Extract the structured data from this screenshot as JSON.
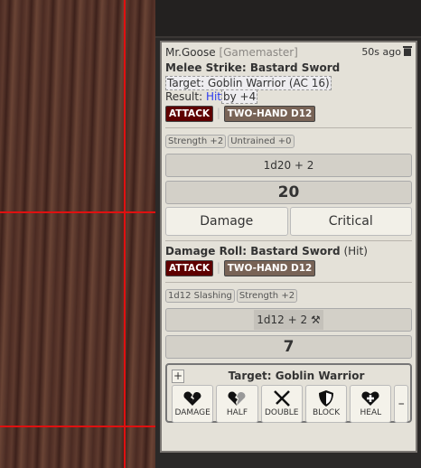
{
  "message": {
    "speaker": "Mr.Goose",
    "role": "[Gamemaster]",
    "time": "50s ago",
    "attack": {
      "title": "Melee Strike: Bastard Sword",
      "target": "Target: Goblin Warrior (AC 16)",
      "result_label": "Result:",
      "result": "Hit",
      "by": "by +4",
      "tags": [
        "ATTACK",
        "TWO-HAND D12"
      ],
      "modifiers": [
        "Strength +2",
        "Untrained +0"
      ],
      "formula": "1d20 + 2",
      "total": "20",
      "damage_btn": "Damage",
      "critical_btn": "Critical"
    },
    "damage": {
      "title": "Damage Roll: Bastard Sword",
      "outcome": "(Hit)",
      "tags": [
        "ATTACK",
        "TWO-HAND D12"
      ],
      "modifiers": [
        "1d12 Slashing",
        "Strength +2"
      ],
      "formula": "1d12 + 2",
      "total": "7"
    },
    "apply": {
      "target": "Target: Goblin Warrior",
      "plus": "+",
      "minus": "–",
      "buttons": [
        "DAMAGE",
        "HALF",
        "DOUBLE",
        "BLOCK",
        "HEAL"
      ]
    }
  }
}
